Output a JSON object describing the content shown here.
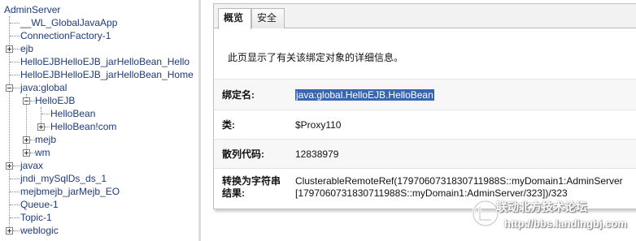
{
  "tree": {
    "root": "AdminServer",
    "items": [
      "__WL_GlobalJavaApp",
      "ConnectionFactory-1",
      "ejb",
      "HelloEJBHelloEJB_jarHelloBean_Hello",
      "HelloEJBHelloEJB_jarHelloBean_Home",
      "java:global",
      "HelloEJB",
      "HelloBean",
      "HelloBean!com",
      "mejb",
      "wm",
      "javax",
      "jndi_mySqlDs_ds_1",
      "mejbmejb_jarMejb_EO",
      "Queue-1",
      "Topic-1",
      "weblogic"
    ]
  },
  "tabs": [
    {
      "label": "概览",
      "active": true
    },
    {
      "label": "安全",
      "active": false
    }
  ],
  "intro": "此页显示了有关该绑定对象的详细信息。",
  "details": {
    "binding_name_label": "绑定名:",
    "binding_name_value": "java:global.HelloEJB.HelloBean",
    "class_label": "类:",
    "class_value": "$Proxy110",
    "hash_label": "散列代码:",
    "hash_value": "12838979",
    "tostring_label_1": "转换为字符串",
    "tostring_label_2": "结果:",
    "tostring_value_1": "ClusterableRemoteRef(1797060731830711988S::myDomain1:AdminServer",
    "tostring_value_2": "[1797060731830711988S::myDomain1:AdminServer/323])/323"
  },
  "watermark": {
    "text": "联动北方技术论坛",
    "url": "http://bbs.landingbj.com"
  },
  "colors": {
    "selection": "#3866b3",
    "tree_text": "#1f3a7a"
  }
}
